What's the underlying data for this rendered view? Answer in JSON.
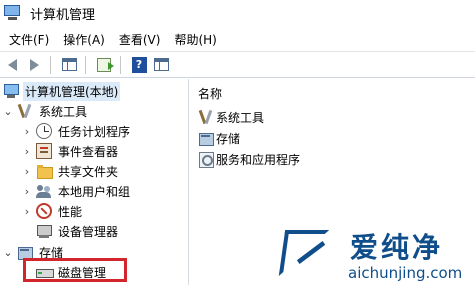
{
  "window": {
    "title": "计算机管理"
  },
  "menu": [
    "文件(F)",
    "操作(A)",
    "查看(V)",
    "帮助(H)"
  ],
  "tree": {
    "root": "计算机管理(本地)",
    "system_tools": "系统工具",
    "task_scheduler": "任务计划程序",
    "event_viewer": "事件查看器",
    "shared_folders": "共享文件夹",
    "local_users": "本地用户和组",
    "performance": "性能",
    "device_manager": "设备管理器",
    "storage": "存储",
    "disk_management": "磁盘管理"
  },
  "right": {
    "column_header": "名称",
    "items": [
      "系统工具",
      "存储",
      "服务和应用程序"
    ]
  },
  "watermark": {
    "name": "爱纯净",
    "url": "aichunjing.com"
  },
  "colors": {
    "highlight": "#d3262c",
    "brand": "#0f4e8a",
    "selection": "#dbeaf9"
  }
}
